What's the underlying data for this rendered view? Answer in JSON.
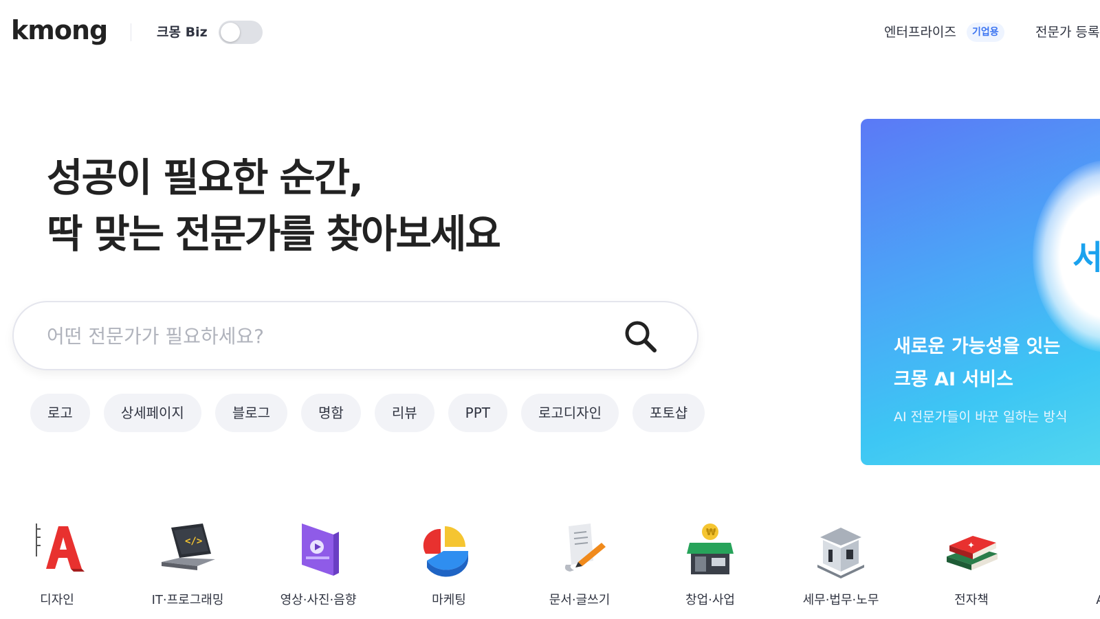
{
  "header": {
    "logo": "kmong",
    "biz_label": "크몽 Biz",
    "enterprise_label": "엔터프라이즈",
    "enterprise_badge": "기업용",
    "register_label": "전문가 등록"
  },
  "hero": {
    "title": "성공이 필요한 순간,\n딱 맞는 전문가를 찾아보세요",
    "search_placeholder": "어떤 전문가가 필요하세요?"
  },
  "chips": [
    "로고",
    "상세페이지",
    "블로그",
    "명함",
    "리뷰",
    "PPT",
    "로고디자인",
    "포토샵"
  ],
  "banner": {
    "glyph": "서",
    "title": "새로운 가능성을 잇는\n크몽 AI 서비스",
    "subtitle": "AI 전문가들이 바꾼 일하는 방식"
  },
  "categories": [
    {
      "label": "디자인",
      "icon": "design-icon"
    },
    {
      "label": "IT·프로그래밍",
      "icon": "laptop-code-icon"
    },
    {
      "label": "영상·사진·음향",
      "icon": "video-icon"
    },
    {
      "label": "마케팅",
      "icon": "pie-chart-icon"
    },
    {
      "label": "문서·글쓰기",
      "icon": "document-pen-icon"
    },
    {
      "label": "창업·사업",
      "icon": "store-icon"
    },
    {
      "label": "세무·법무·노무",
      "icon": "building-icon"
    },
    {
      "label": "전자책",
      "icon": "books-icon"
    },
    {
      "label": "AI",
      "icon": "ai-icon"
    }
  ],
  "colors": {
    "accent": "#3b74f1",
    "chip_bg": "#f2f3f7",
    "banner_start": "#5b79f6",
    "banner_end": "#52d6ef"
  }
}
